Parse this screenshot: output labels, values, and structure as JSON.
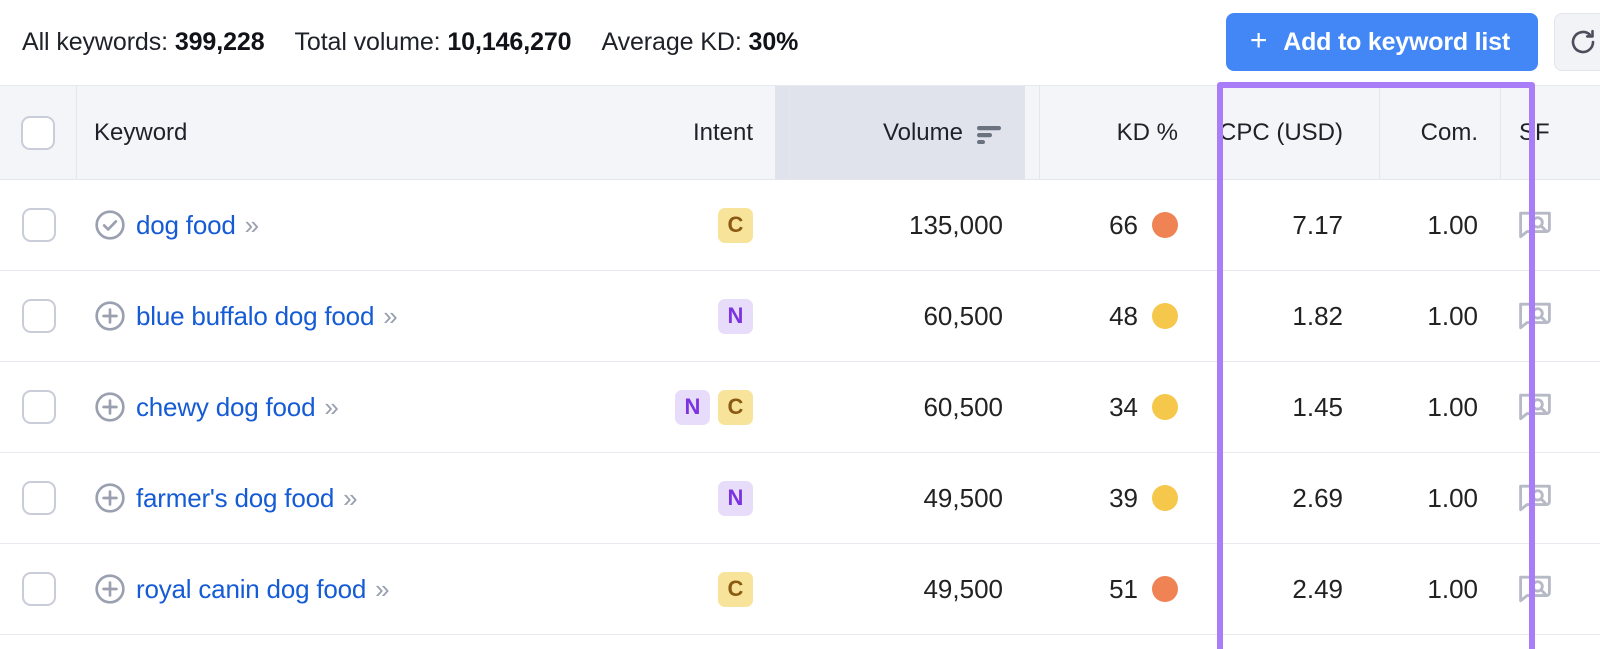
{
  "toolbar": {
    "stats": [
      {
        "label": "All keywords:",
        "value": "399,228"
      },
      {
        "label": "Total volume:",
        "value": "10,146,270"
      },
      {
        "label": "Average KD:",
        "value": "30%"
      }
    ],
    "add_button_label": "Add to keyword list",
    "add_button_icon": "plus-icon",
    "refresh_icon": "refresh-icon",
    "accent_color": "#4287f5"
  },
  "table": {
    "columns": {
      "keyword": "Keyword",
      "intent": "Intent",
      "volume": "Volume",
      "kd": "KD %",
      "cpc": "CPC (USD)",
      "com": "Com.",
      "sf": "SF"
    },
    "sorted_column": "volume",
    "sort_icon": "sort-descending-icon",
    "highlight": {
      "columns": [
        "cpc",
        "com"
      ],
      "color": "#a97cf8"
    },
    "rows": [
      {
        "keyword": "dog food",
        "row_icon": "check-circle-icon",
        "expand_icon": "double-chevron-right-icon",
        "intent": [
          "C"
        ],
        "volume": "135,000",
        "kd": "66",
        "kd_color": "#ef8354",
        "cpc": "7.17",
        "com": "1.00",
        "sf_icon": "serp-feature-icon"
      },
      {
        "keyword": "blue buffalo dog food",
        "row_icon": "plus-circle-icon",
        "expand_icon": "double-chevron-right-icon",
        "intent": [
          "N"
        ],
        "volume": "60,500",
        "kd": "48",
        "kd_color": "#f5c council",
        "cpc": "1.82",
        "com": "1.00",
        "sf_icon": "serp-feature-icon"
      },
      {
        "keyword": "chewy dog food",
        "row_icon": "plus-circle-icon",
        "expand_icon": "double-chevron-right-icon",
        "intent": [
          "N",
          "C"
        ],
        "volume": "60,500",
        "kd": "34",
        "kd_color": "#f5c84b",
        "cpc": "1.45",
        "com": "1.00",
        "sf_icon": "serp-feature-icon"
      },
      {
        "keyword": "farmer's dog food",
        "row_icon": "plus-circle-icon",
        "expand_icon": "double-chevron-right-icon",
        "intent": [
          "N"
        ],
        "volume": "49,500",
        "kd": "39",
        "kd_color": "#f5c84b",
        "cpc": "2.69",
        "com": "1.00",
        "sf_icon": "serp-feature-icon"
      },
      {
        "keyword": "royal canin dog food",
        "row_icon": "plus-circle-icon",
        "expand_icon": "double-chevron-right-icon",
        "intent": [
          "C"
        ],
        "volume": "49,500",
        "kd": "51",
        "kd_color": "#ef8354",
        "cpc": "2.49",
        "com": "1.00",
        "sf_icon": "serp-feature-icon"
      }
    ]
  }
}
